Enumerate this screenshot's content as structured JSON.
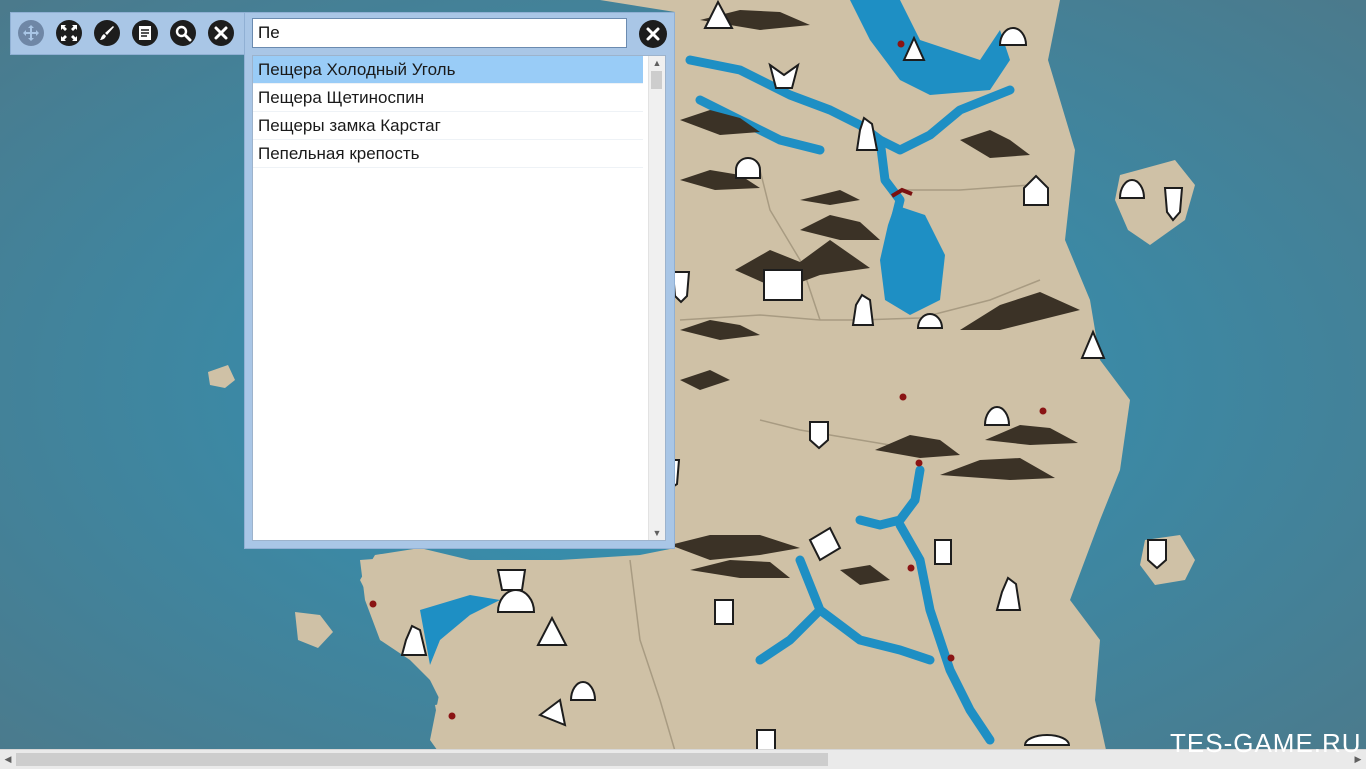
{
  "toolbar": {
    "buttons": [
      {
        "name": "move-button",
        "icon": "move-icon",
        "enabled": false
      },
      {
        "name": "fullscreen-button",
        "icon": "expand-icon",
        "enabled": true
      },
      {
        "name": "style-button",
        "icon": "brush-icon",
        "enabled": true
      },
      {
        "name": "notes-button",
        "icon": "notes-icon",
        "enabled": true
      },
      {
        "name": "search-button",
        "icon": "search-icon",
        "enabled": true
      },
      {
        "name": "close-button",
        "icon": "close-icon",
        "enabled": true
      }
    ]
  },
  "search": {
    "value": "Пе",
    "clear_icon": "close-icon"
  },
  "results": [
    {
      "label": "Пещера Холодный Уголь",
      "selected": true
    },
    {
      "label": "Пещера Щетиноспин",
      "selected": false
    },
    {
      "label": "Пещеры замка Карстаг",
      "selected": false
    },
    {
      "label": "Пепельная крепость",
      "selected": false
    }
  ],
  "watermark": "TES-GAME.RU",
  "colors": {
    "water": "#3f7f97",
    "land": "#cfc1a6",
    "river": "#1e8fc4",
    "panel": "#a9c6e6",
    "selected_row": "#99ccf7"
  }
}
